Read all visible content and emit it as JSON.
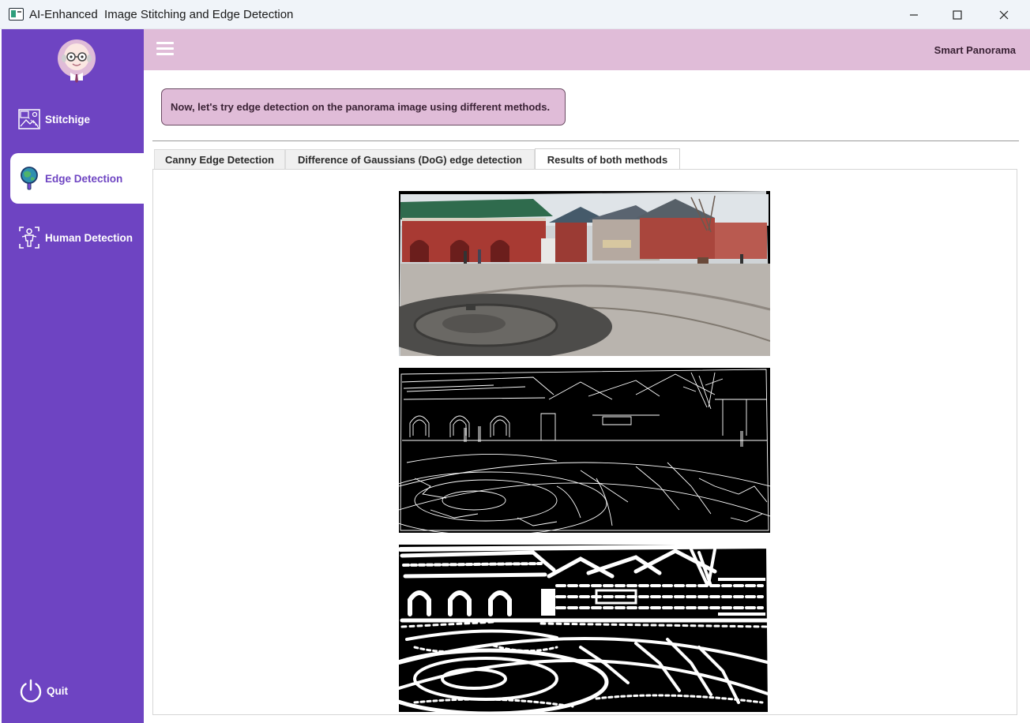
{
  "window": {
    "title": "AI-Enhanced  Image Stitching and Edge Detection",
    "icon": "app-window-icon",
    "controls": [
      "minimize-icon",
      "maximize-icon",
      "close-icon"
    ]
  },
  "sidebar": {
    "avatar": "bald-professor-avatar",
    "items": [
      {
        "label": "Stitchige",
        "icon": "stitch-image-icon"
      },
      {
        "label": "Edge Detection",
        "icon": "magnifier-globe-icon",
        "active": true
      },
      {
        "label": "Human Detection",
        "icon": "human-target-icon"
      }
    ],
    "quit": {
      "label": "Quit",
      "icon": "power-icon"
    }
  },
  "header": {
    "menu_icon": "hamburger-menu-icon",
    "brand": "Smart Panorama"
  },
  "message": "Now, let's try edge detection on the panorama image using different methods.",
  "tabs": [
    {
      "label": "Canny Edge Detection",
      "selected": false
    },
    {
      "label": "Difference of Gaussians (DoG) edge detection",
      "selected": false
    },
    {
      "label": "Results of both methods",
      "selected": true
    }
  ],
  "images": [
    {
      "name": "panorama-image"
    },
    {
      "name": "canny-edge-result-image"
    },
    {
      "name": "dog-edge-result-image"
    }
  ],
  "colors": {
    "sidebar": "#6e44c2",
    "header": "#e0bcd8",
    "accent_text": "#6e44c2",
    "roof_green": "#2f6b4d",
    "wall_red": "#a83a33"
  }
}
